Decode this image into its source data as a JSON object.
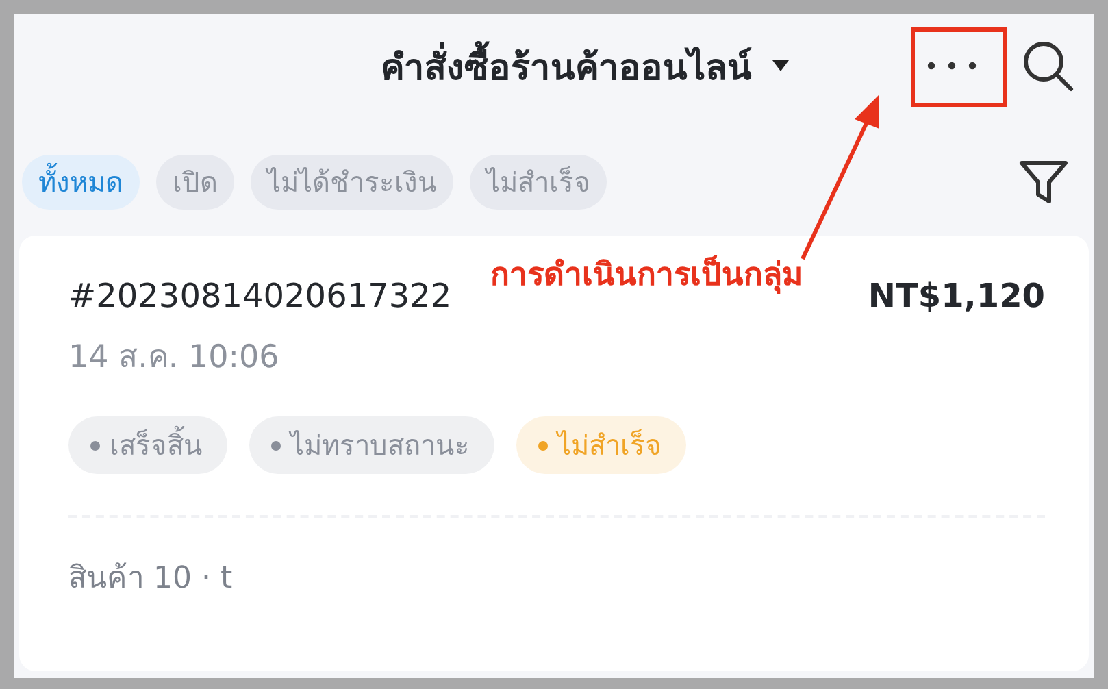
{
  "header": {
    "title": "คำสั่งซื้อร้านค้าออนไลน์"
  },
  "tabs": [
    {
      "label": "ทั้งหมด",
      "selected": true
    },
    {
      "label": "เปิด",
      "selected": false
    },
    {
      "label": "ไม่ได้ชำระเงิน",
      "selected": false
    },
    {
      "label": "ไม่สำเร็จ",
      "selected": false
    }
  ],
  "order": {
    "number": "#20230814020617322",
    "amount": "NT$1,120",
    "date": "14 ส.ค. 10:06",
    "tags": [
      {
        "label": "เสร็จสิ้น",
        "color": "#8a8f9a"
      },
      {
        "label": "ไม่ทราบสถานะ",
        "color": "#8a8f9a"
      },
      {
        "label": "ไม่สำเร็จ",
        "color": "#f0a426"
      }
    ],
    "items": "สินค้า 10 · t"
  },
  "annotation": {
    "text": "การดำเนินการเป็นกลุ่ม"
  }
}
